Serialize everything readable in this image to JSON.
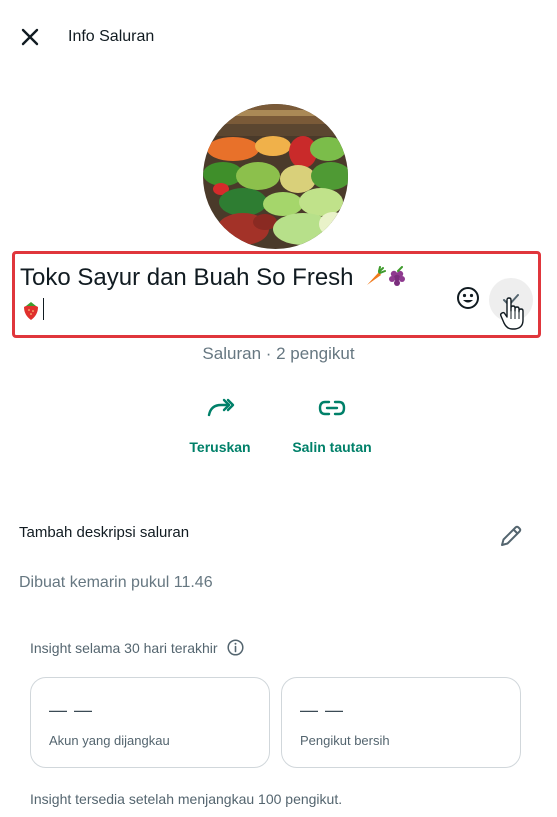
{
  "header": {
    "title": "Info Saluran"
  },
  "channel": {
    "name": "Toko Sayur dan Buah So Fresh",
    "name_emojis": [
      "carrot",
      "grapes",
      "strawberry"
    ],
    "meta": "Saluran · 2 pengikut"
  },
  "actions": [
    {
      "label": "Teruskan",
      "icon": "forward-icon"
    },
    {
      "label": "Salin tautan",
      "icon": "link-icon"
    }
  ],
  "description": {
    "label": "Tambah deskripsi saluran"
  },
  "created": "Dibuat kemarin pukul 11.46",
  "insight": {
    "heading": "Insight selama 30 hari terakhir",
    "cards": [
      {
        "value": "— —",
        "label": "Akun yang dijangkau"
      },
      {
        "value": "— —",
        "label": "Pengikut bersih"
      }
    ],
    "note": "Insight tersedia setelah menjangkau 100 pengikut."
  },
  "colors": {
    "accent": "#008069",
    "highlight_border": "#e0363c",
    "secondary_text": "#667781"
  }
}
